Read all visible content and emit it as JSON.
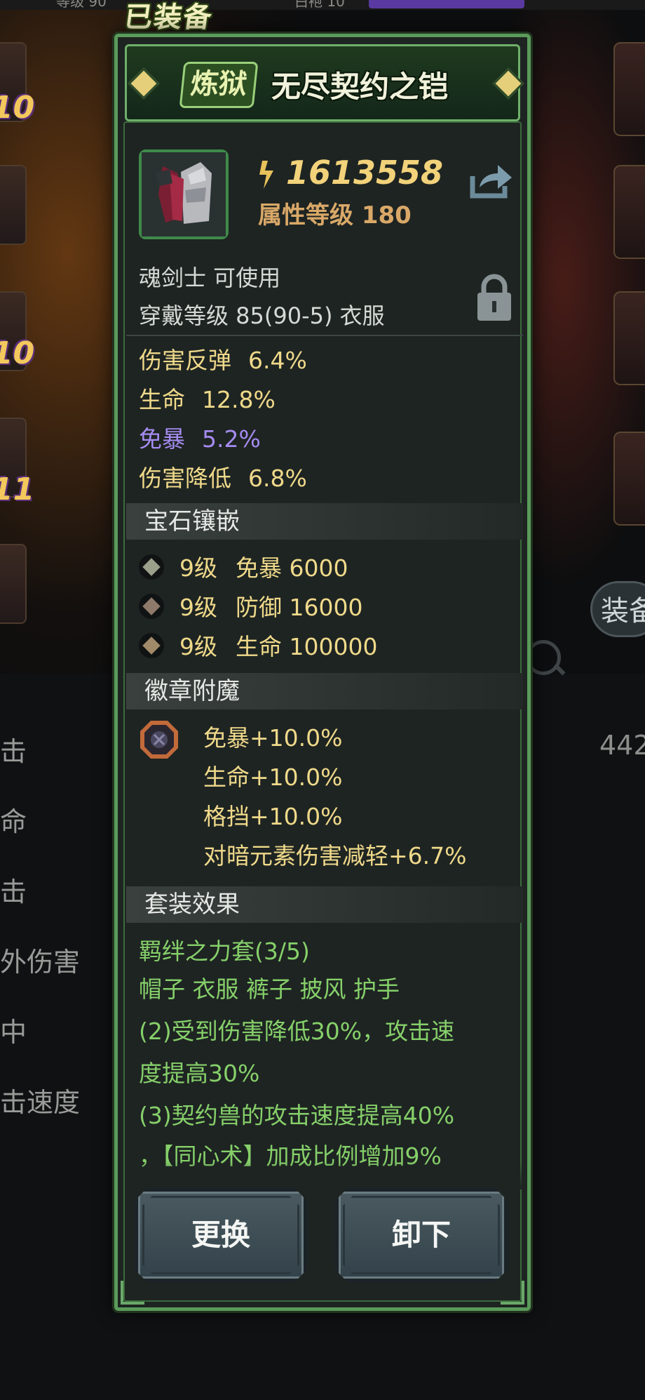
{
  "background": {
    "top_left_text": "等级 90",
    "top_mid_text": "白袍 10",
    "equipped_badge": "已装备",
    "side_numbers": [
      "10",
      "10",
      "11"
    ],
    "equip_button_partial": "装备",
    "left_stats": [
      "击",
      "命",
      "击",
      "外伤害",
      "中",
      "击速度"
    ],
    "right_stat_partial": "442"
  },
  "panel": {
    "title_tag": "炼狱",
    "item_name": "无尽契约之铠",
    "power_value": "1613558",
    "attribute_level": "属性等级 180",
    "class_requirement": "魂剑士 可使用",
    "wear_requirement": "穿戴等级 85(90-5) 衣服",
    "attributes": [
      {
        "name": "伤害反弹",
        "value": "6.4%",
        "color": "#efd98a"
      },
      {
        "name": "生命",
        "value": "12.8%",
        "color": "#efd98a"
      },
      {
        "name": "免暴",
        "value": "5.2%",
        "color": "#a58bf0"
      },
      {
        "name": "伤害降低",
        "value": "6.8%",
        "color": "#efd98a"
      }
    ],
    "gem_section_title": "宝石镶嵌",
    "gems": [
      {
        "level": "9级",
        "stat": "免暴 6000",
        "icon": "gem-icon"
      },
      {
        "level": "9级",
        "stat": "防御 16000",
        "icon": "gem-icon"
      },
      {
        "level": "9级",
        "stat": "生命 100000",
        "icon": "gem-icon"
      }
    ],
    "badge_section_title": "徽章附魔",
    "enchantments": [
      "免暴+10.0%",
      "生命+10.0%",
      "格挡+10.0%",
      "对暗元素伤害减轻+6.7%"
    ],
    "set_section_title": "套装效果",
    "set_name": "羁绊之力套(3/5)",
    "set_parts": "帽子 衣服 裤子 披风 护手",
    "set_effects": [
      "(2)受到伤害降低30%，攻击速",
      "度提高30%",
      "(3)契约兽的攻击速度提高40%",
      "，【同心术】加成比例增加9%"
    ],
    "replace_button": "更换",
    "unequip_button": "卸下"
  },
  "colors": {
    "panel_border": "#5a9a5a",
    "gold_text": "#efd98a",
    "purple_text": "#a58bf0",
    "set_green": "#86d06a"
  }
}
